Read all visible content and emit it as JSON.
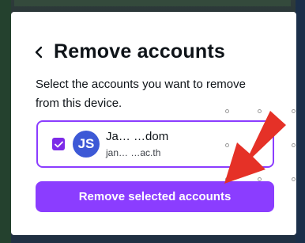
{
  "modal": {
    "title": "Remove accounts",
    "description": "Select the accounts you want to remove from this device.",
    "account": {
      "avatar_initials": "JS",
      "name": "Ja… …dom",
      "email": "jan… …ac.th",
      "checked": true
    },
    "remove_button_label": "Remove selected accounts"
  },
  "colors": {
    "accent": "#8b3dff",
    "checkbox": "#7d2ae8",
    "avatar": "#3d59d6",
    "annotation_arrow": "#e53127"
  },
  "icons": {
    "back": "chevron-left-icon",
    "check": "checkmark-icon",
    "annotation": "red-arrow-icon"
  }
}
